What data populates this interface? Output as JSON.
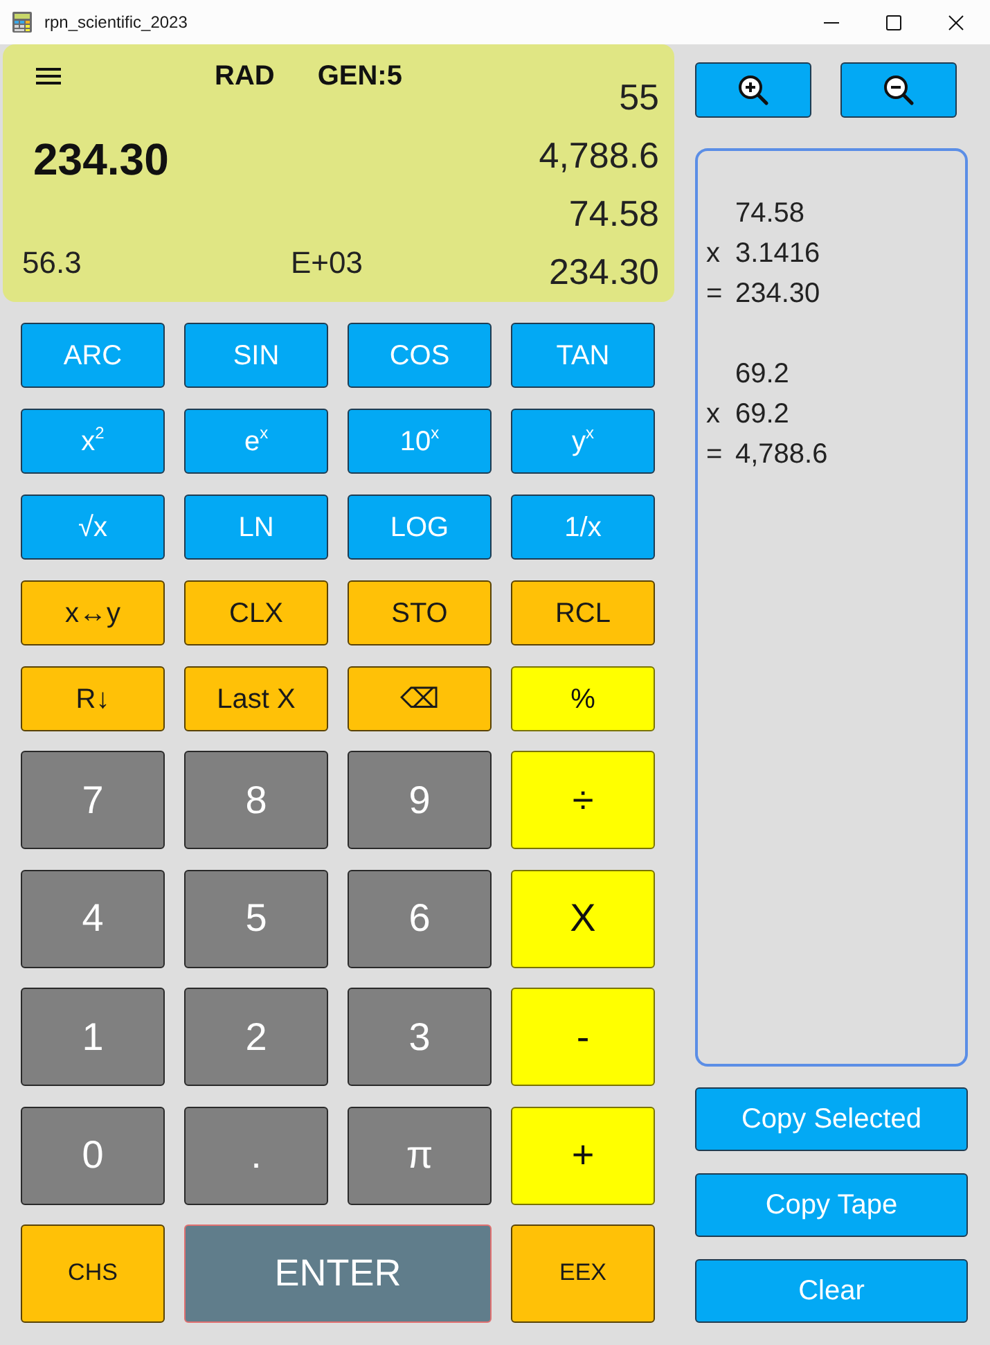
{
  "window": {
    "title": "rpn_scientific_2023"
  },
  "display": {
    "angle_mode": "RAD",
    "format": "GEN:5",
    "x_value": "234.30",
    "stack": [
      "55",
      "4,788.6",
      "74.58",
      "234.30"
    ],
    "memory": "56.3",
    "exponent": "E+03"
  },
  "function_keys": [
    [
      {
        "label": "ARC",
        "kind": "function"
      },
      {
        "label": "SIN",
        "kind": "function"
      },
      {
        "label": "COS",
        "kind": "function"
      },
      {
        "label": "TAN",
        "kind": "function"
      }
    ],
    [
      {
        "label": "x$^{2}$",
        "kind": "function"
      },
      {
        "label": "e$^{x}$",
        "kind": "function"
      },
      {
        "label": "10$^{x}$",
        "kind": "function"
      },
      {
        "label": "y$^{x}$",
        "kind": "function"
      }
    ],
    [
      {
        "label": "√x",
        "kind": "function"
      },
      {
        "label": "LN",
        "kind": "function"
      },
      {
        "label": "LOG",
        "kind": "function"
      },
      {
        "label": "1/x",
        "kind": "function"
      }
    ],
    [
      {
        "label": "x↔y",
        "kind": "stack"
      },
      {
        "label": "CLX",
        "kind": "stack"
      },
      {
        "label": "STO",
        "kind": "stack"
      },
      {
        "label": "RCL",
        "kind": "stack"
      }
    ],
    [
      {
        "label": "R↓",
        "kind": "stack"
      },
      {
        "label": "Last X",
        "kind": "stack"
      },
      {
        "label": "⌫",
        "kind": "stack"
      },
      {
        "label": "%",
        "kind": "operator"
      }
    ]
  ],
  "number_keys": [
    [
      {
        "label": "7",
        "kind": "digit"
      },
      {
        "label": "8",
        "kind": "digit"
      },
      {
        "label": "9",
        "kind": "digit"
      },
      {
        "label": "÷",
        "kind": "operator"
      }
    ],
    [
      {
        "label": "4",
        "kind": "digit"
      },
      {
        "label": "5",
        "kind": "digit"
      },
      {
        "label": "6",
        "kind": "digit"
      },
      {
        "label": "X",
        "kind": "operator"
      }
    ],
    [
      {
        "label": "1",
        "kind": "digit"
      },
      {
        "label": "2",
        "kind": "digit"
      },
      {
        "label": "3",
        "kind": "digit"
      },
      {
        "label": "-",
        "kind": "operator"
      }
    ],
    [
      {
        "label": "0",
        "kind": "digit"
      },
      {
        "label": ".",
        "kind": "digit"
      },
      {
        "label": "π",
        "kind": "digit"
      },
      {
        "label": "+",
        "kind": "operator"
      }
    ],
    [
      {
        "label": "CHS",
        "kind": "stack"
      },
      {
        "label": "ENTER",
        "kind": "enter"
      },
      {
        "label": "EEX",
        "kind": "stack"
      }
    ]
  ],
  "tape": {
    "entries": [
      {
        "lines": [
          {
            "value": "74.58"
          },
          {
            "op": "x",
            "value": "3.1416"
          },
          {
            "op": "=",
            "value": "234.30"
          }
        ]
      },
      {
        "lines": [
          {
            "value": "69.2"
          },
          {
            "op": "x",
            "value": "69.2"
          },
          {
            "op": "=",
            "value": "4,788.6"
          }
        ]
      }
    ]
  },
  "tape_buttons": [
    "Copy Selected",
    "Copy Tape",
    "Clear"
  ]
}
